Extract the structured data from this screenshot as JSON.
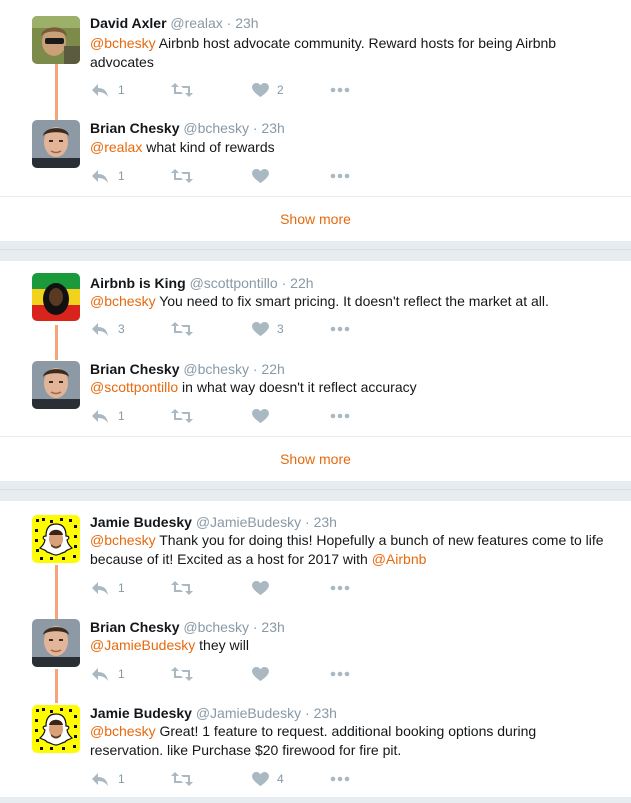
{
  "colors": {
    "accent": "#e8690d",
    "muted": "#8899a6",
    "thread": "#f5a47a"
  },
  "icons": {
    "reply": "reply-icon",
    "retweet": "retweet-icon",
    "like": "heart-icon",
    "more": "more-dots-icon"
  },
  "conversations": [
    {
      "tweets": [
        {
          "avatar": "david-avatar",
          "name": "David Axler",
          "handle": "@realax",
          "time": "23h",
          "mention": "@bchesky",
          "body": " Airbnb host advocate community.  Reward hosts for being Airbnb advocates",
          "replies": "1",
          "retweets": "",
          "likes": "2"
        },
        {
          "avatar": "brian-avatar",
          "name": "Brian Chesky",
          "handle": "@bchesky",
          "time": "23h",
          "mention": "@realax",
          "body": " what kind of rewards",
          "replies": "1",
          "retweets": "",
          "likes": ""
        }
      ],
      "show_more": "Show more"
    },
    {
      "tweets": [
        {
          "avatar": "bob-avatar",
          "name": "Airbnb is King",
          "handle": "@scottpontillo",
          "time": "22h",
          "mention": "@bchesky",
          "body": " You need to fix smart pricing. It doesn't reflect the market at all.",
          "replies": "3",
          "retweets": "",
          "likes": "3"
        },
        {
          "avatar": "brian-avatar",
          "name": "Brian Chesky",
          "handle": "@bchesky",
          "time": "22h",
          "mention": "@scottpontillo",
          "body": " in what way doesn't it reflect accuracy",
          "replies": "1",
          "retweets": "",
          "likes": ""
        }
      ],
      "show_more": "Show more"
    },
    {
      "tweets": [
        {
          "avatar": "snapcode-avatar",
          "name": "Jamie Budesky",
          "handle": "@JamieBudesky",
          "time": "23h",
          "mention": "@bchesky",
          "body": " Thank you for doing this! Hopefully a bunch of new features come to life because of it! Excited as a host for 2017 with ",
          "mention2": "@Airbnb",
          "replies": "1",
          "retweets": "",
          "likes": ""
        },
        {
          "avatar": "brian-avatar",
          "name": "Brian Chesky",
          "handle": "@bchesky",
          "time": "23h",
          "mention": "@JamieBudesky",
          "body": " they will",
          "replies": "1",
          "retweets": "",
          "likes": ""
        },
        {
          "avatar": "snapcode-avatar",
          "name": "Jamie Budesky",
          "handle": "@JamieBudesky",
          "time": "23h",
          "mention": "@bchesky",
          "body": " Great! 1 feature to request. additional booking options during reservation. like Purchase $20 firewood for fire pit.",
          "replies": "1",
          "retweets": "",
          "likes": "4"
        }
      ]
    }
  ]
}
